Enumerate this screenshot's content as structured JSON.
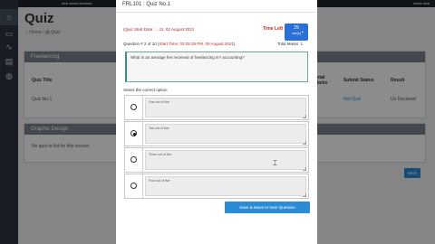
{
  "app": {
    "topbar": {
      "brand": "■■■ ■■■■ ■■■■■■",
      "user": "■■■■ ■■■"
    },
    "page_title": "Quiz",
    "breadcrumb": "⌂ Home  ›  ▤  Quiz",
    "panels": [
      {
        "title": "Freelancing",
        "columns": [
          "Quiz Title",
          "Total Marks",
          "Submit Status",
          "Result"
        ],
        "rows": [
          [
            "Quiz No.1",
            "",
            "Not Quiz",
            "Un Declared"
          ]
        ]
      },
      {
        "title": "Graphic Design",
        "empty_message": "No quiz to list for this course."
      }
    ],
    "back_label": "Back"
  },
  "modal": {
    "title": "FRL101 : Quiz No.1",
    "schedule": "(Quiz Start Date : ...11, 02 August 2021",
    "time_left_label": "Time Left",
    "timer": {
      "value": "29",
      "unit": "sec(s)"
    },
    "question_prefix": "Question # 2 of 10 (",
    "question_deadline": "Start Time: 02:05:39 PM, 09 August 2021",
    "question_suffix": ")",
    "total_marks": "Total Marks: 1",
    "question_text": "What is an average fee received of freelancing in? accounting?",
    "instruction": "Select the correct option",
    "options": [
      {
        "text": "One out of five",
        "selected": false
      },
      {
        "text": "Two out of five",
        "selected": true
      },
      {
        "text": "Three out of five",
        "selected": false
      },
      {
        "text": "Four out of five",
        "selected": false
      }
    ],
    "save_label": "Save & Move to Next Question"
  }
}
